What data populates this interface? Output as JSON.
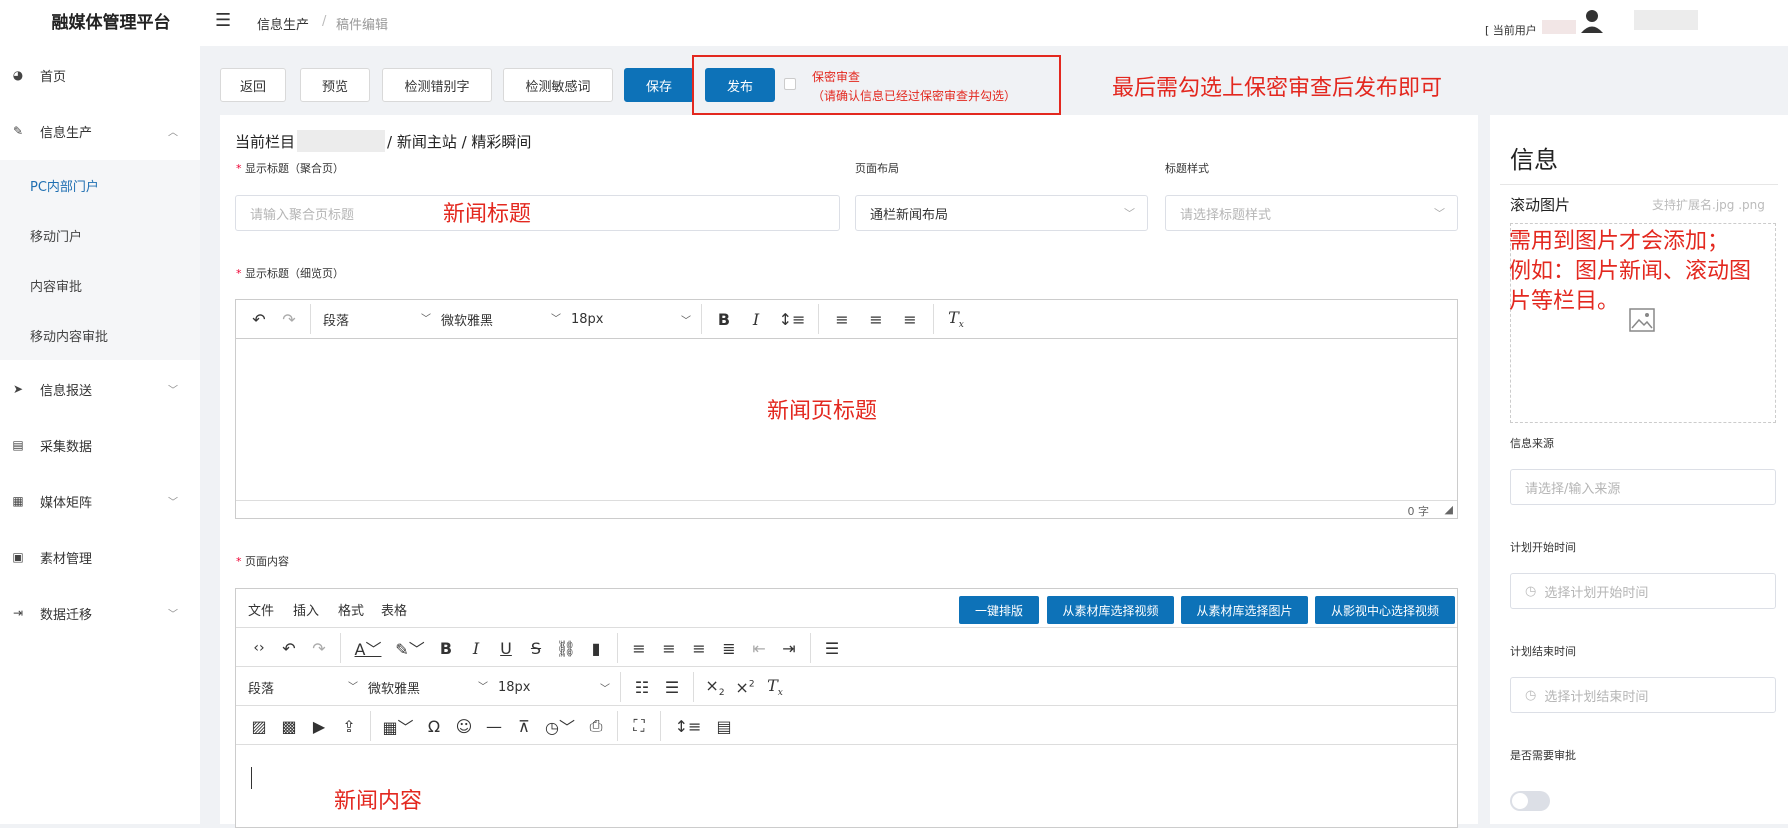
{
  "app_title": "融媒体管理平台",
  "sidebar": {
    "items": [
      {
        "label": "首页",
        "icon": "dashboard-icon",
        "expandable": false
      },
      {
        "label": "信息生产",
        "icon": "edit-icon",
        "expandable": true,
        "expanded": true
      },
      {
        "label": "信息报送",
        "icon": "send-icon",
        "expandable": true
      },
      {
        "label": "采集数据",
        "icon": "document-icon",
        "expandable": false
      },
      {
        "label": "媒体矩阵",
        "icon": "grid-icon",
        "expandable": true
      },
      {
        "label": "素材管理",
        "icon": "printer-icon",
        "expandable": false
      },
      {
        "label": "数据迁移",
        "icon": "export-icon",
        "expandable": true
      }
    ],
    "subitems": [
      "PC内部门户",
      "移动门户",
      "内容审批",
      "移动内容审批"
    ]
  },
  "header": {
    "breadcrumb": [
      "信息生产",
      "稿件编辑"
    ],
    "current_user_label": "[ 当前用户"
  },
  "toolbar": {
    "back": "返回",
    "preview": "预览",
    "check_typo": "检测错别字",
    "check_sensitive": "检测敏感词",
    "save": "保存",
    "publish": "发布",
    "secret_title": "保密审查",
    "secret_hint": "（请确认信息已经过保密审查并勾选）",
    "annotation": "最后需勾选上保密审查后发布即可"
  },
  "form": {
    "column_prefix": "当前栏目",
    "column_path": "/ 新闻主站 / 精彩瞬间",
    "title_aggregate_label": "显示标题（聚合页）",
    "title_aggregate_placeholder": "请输入聚合页标题",
    "title_annotation": "新闻标题",
    "layout_label": "页面布局",
    "layout_value": "通栏新闻布局",
    "title_style_label": "标题样式",
    "title_style_placeholder": "请选择标题样式",
    "title_detail_label": "显示标题（细览页）",
    "detail_annotation": "新闻页标题",
    "char_count": "0 字",
    "editor1": {
      "paragraph": "段落",
      "font": "微软雅黑",
      "size": "18px"
    },
    "content_label": "页面内容",
    "editor2": {
      "menus": [
        "文件",
        "插入",
        "格式",
        "表格"
      ],
      "actions": [
        "一键排版",
        "从素材库选择视频",
        "从素材库选择图片",
        "从影视中心选择视频"
      ],
      "paragraph": "段落",
      "font": "微软雅黑",
      "size": "18px"
    },
    "content_annotation": "新闻内容"
  },
  "info": {
    "title": "信息",
    "scroll_image_label": "滚动图片",
    "scroll_image_hint": "支持扩展名.jpg .png",
    "image_annotation": [
      "需用到图片才会添加；",
      "例如：图片新闻、滚动图",
      "片等栏目。"
    ],
    "source_label": "信息来源",
    "source_placeholder": "请选择/输入来源",
    "start_label": "计划开始时间",
    "start_placeholder": "选择计划开始时间",
    "end_label": "计划结束时间",
    "end_placeholder": "选择计划结束时间",
    "approval_label": "是否需要审批"
  },
  "colors": {
    "primary": "#0d72b8",
    "annotation": "#e3281f"
  }
}
